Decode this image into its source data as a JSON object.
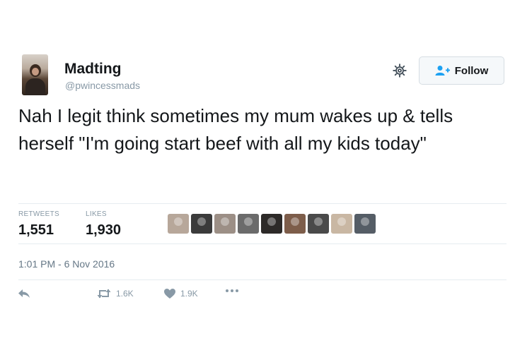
{
  "user": {
    "name": "Madting",
    "handle": "@pwincessmads"
  },
  "follow_button": {
    "label": "Follow",
    "icon": "add-user-icon"
  },
  "settings_icon": "gear-icon",
  "tweet": {
    "text": "Nah I legit think sometimes my mum wakes up & tells herself \"I'm going start beef with all my kids today\""
  },
  "stats": {
    "retweets_label": "RETWEETS",
    "retweets_value": "1,551",
    "likes_label": "LIKES",
    "likes_value": "1,930"
  },
  "liker_colors": [
    "#b7a79a",
    "#3b3b3b",
    "#9c8f86",
    "#6b6b6b",
    "#2d2a28",
    "#7d5d4a",
    "#4a4a4a",
    "#c9b7a3",
    "#555d66"
  ],
  "timestamp": "1:01 PM - 6 Nov 2016",
  "actions": {
    "reply_icon": "reply-icon",
    "retweet_icon": "retweet-icon",
    "retweet_count": "1.6K",
    "like_icon": "heart-icon",
    "like_count": "1.9K",
    "more_icon": "more-dots-icon"
  }
}
